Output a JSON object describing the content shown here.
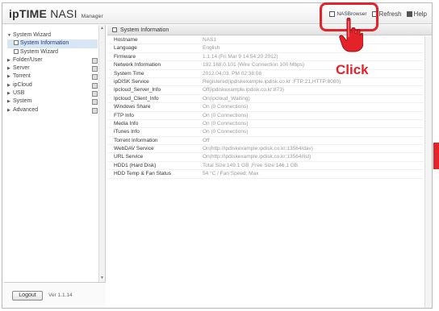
{
  "header": {
    "logo_brand": "ipTIME",
    "logo_nas": "NAS",
    "logo_roman": "I",
    "logo_sub": "Manager",
    "nas_browser": "NASBrowser",
    "refresh": "Refresh",
    "help": "Help"
  },
  "annotation": {
    "click_label": "Click",
    "highlight_color": "#e4222a"
  },
  "sidebar": {
    "items": [
      {
        "label": "System Wizard",
        "level": 0,
        "expanded": true
      },
      {
        "label": "System Information",
        "level": 1,
        "selected": true
      },
      {
        "label": "System Wizard",
        "level": 1
      },
      {
        "label": "Folder/User",
        "level": 0
      },
      {
        "label": "Server",
        "level": 0
      },
      {
        "label": "Torrent",
        "level": 0
      },
      {
        "label": "ipCloud",
        "level": 0
      },
      {
        "label": "USB",
        "level": 0
      },
      {
        "label": "System",
        "level": 0
      },
      {
        "label": "Advanced",
        "level": 0
      }
    ],
    "logout_label": "Logout",
    "version": "Ver 1.1.14"
  },
  "main": {
    "title": "System Information",
    "rows": [
      {
        "label": "Hostname",
        "value": "NAS1"
      },
      {
        "label": "Language",
        "value": "English"
      },
      {
        "label": "Firmware",
        "value": "1.1.14 (Fri Mar 9 14:54:20 2012)"
      },
      {
        "label": "Network Information",
        "value": "192.168.0.101 (Wire Connection 100 Mbps)"
      },
      {
        "label": "System Time",
        "value": "2012.04.03. PM 02:38:08"
      },
      {
        "label": "ipDISK Service",
        "value": "Registered(ipdiskexample.ipdisk.co.kr :FTP:21,HTTP:8080)"
      },
      {
        "label": "Ipcloud_Server_Info",
        "value": "Off(ipdiskexample.ipdisk.co.kr:873)"
      },
      {
        "label": "Ipcloud_Client_Info",
        "value": "On(ipcloud_Waiting)"
      },
      {
        "label": "Windows Share",
        "value": "On (0 Connections)"
      },
      {
        "label": "FTP Info",
        "value": "On (0 Connections)"
      },
      {
        "label": "Media Info",
        "value": "On (0 Connections)"
      },
      {
        "label": "iTunes Info",
        "value": "On (0 Connections)"
      },
      {
        "label": "Torrent Information",
        "value": "Off"
      },
      {
        "label": "WebDAV Service",
        "value": "On(http://ipdiskexample.ipdisk.co.kr:13564/dav)"
      },
      {
        "label": "URL Service",
        "value": "On(http://ipdiskexample.ipdisk.co.kr:13564/list)"
      },
      {
        "label": "HDD1 (Hard Disk)",
        "value": "Total Size:149.1 GB ,Free Size:146.1 GB"
      },
      {
        "label": "HDD Temp & Fan Status",
        "value": "54 °C / Fan Speed: Max"
      }
    ]
  }
}
